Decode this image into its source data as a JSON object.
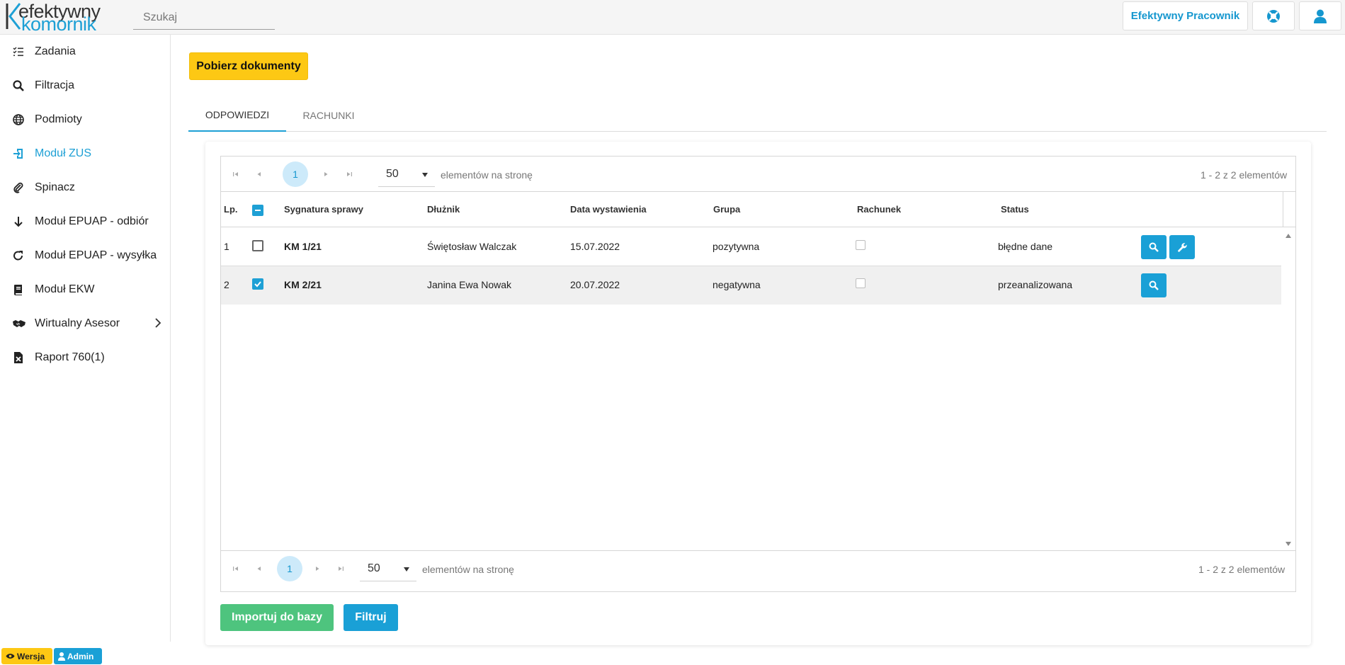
{
  "header": {
    "logo_line1": "efektywny",
    "logo_line2": "komornik",
    "search_placeholder": "Szukaj",
    "worker_button": "Efektywny Pracownik",
    "help_icon": "lifebuoy-icon",
    "user_icon": "user-icon"
  },
  "sidebar": {
    "items": [
      {
        "label": "Zadania",
        "icon": "task-list-icon"
      },
      {
        "label": "Filtracja",
        "icon": "search-icon"
      },
      {
        "label": "Podmioty",
        "icon": "globe-icon"
      },
      {
        "label": "Moduł ZUS",
        "icon": "sign-in-icon",
        "active": true
      },
      {
        "label": "Spinacz",
        "icon": "paperclip-icon"
      },
      {
        "label": "Moduł EPUAP - odbiór",
        "icon": "arrow-down-icon"
      },
      {
        "label": "Moduł EPUAP - wysyłka",
        "icon": "redo-icon"
      },
      {
        "label": "Moduł EKW",
        "icon": "book-icon"
      },
      {
        "label": "Wirtualny Asesor",
        "icon": "handshake-icon",
        "has_submenu": true
      },
      {
        "label": "Raport 760(1)",
        "icon": "excel-file-icon"
      }
    ]
  },
  "main": {
    "download_button": "Pobierz dokumenty",
    "tabs": [
      {
        "label": "ODPOWIEDZI",
        "active": true
      },
      {
        "label": "RACHUNKI",
        "active": false
      }
    ]
  },
  "grid": {
    "pager": {
      "page": "1",
      "page_size": "50",
      "page_size_label": "elementów na stronę",
      "info": "1 - 2 z 2 elementów"
    },
    "columns": [
      "Lp.",
      "Sygnatura sprawy",
      "Dłużnik",
      "Data wystawienia",
      "Grupa",
      "Rachunek",
      "Status"
    ],
    "rows": [
      {
        "lp": "1",
        "checked": false,
        "sygnatura": "KM 1/21",
        "dluznik": "Świętosław Walczak",
        "data": "15.07.2022",
        "grupa": "pozytywna",
        "rachunek": false,
        "status": "błędne dane",
        "actions": [
          "search-icon",
          "wrench-icon"
        ]
      },
      {
        "lp": "2",
        "checked": true,
        "sygnatura": "KM 2/21",
        "dluznik": "Janina Ewa Nowak",
        "data": "20.07.2022",
        "grupa": "negatywna",
        "rachunek": false,
        "status": "przeanalizowana",
        "actions": [
          "search-icon"
        ]
      }
    ]
  },
  "footer_buttons": {
    "import": "Importuj do bazy",
    "filter": "Filtruj"
  },
  "badges": {
    "version": "Wersja",
    "admin": "Admin"
  },
  "colors": {
    "accent": "#1ea0d5",
    "yellow": "#fdc814",
    "green": "#4ec47e"
  }
}
